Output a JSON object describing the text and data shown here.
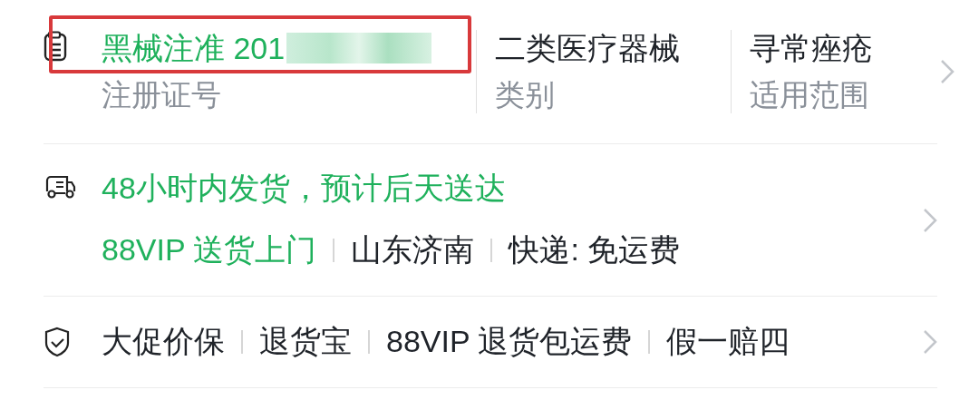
{
  "rows": [
    {
      "kind": "specs",
      "items": [
        {
          "value": "黑械注准 201",
          "label": "注册证号",
          "highlighted": true,
          "redacted": true
        },
        {
          "value": "二类医疗器械",
          "label": "类别",
          "highlighted": false,
          "redacted": false
        },
        {
          "value": "寻常痤疮",
          "label": "适用范围",
          "highlighted": false,
          "redacted": false
        }
      ]
    },
    {
      "kind": "delivery",
      "headline": "48小时内发货，预计后天送达",
      "tags": [
        {
          "text": "88VIP 送货上门",
          "accent": true
        },
        {
          "text": "山东济南",
          "accent": false
        },
        {
          "text": "快递: 免运费",
          "accent": false
        }
      ]
    },
    {
      "kind": "guarantee",
      "tags": [
        {
          "text": "大促价保",
          "accent": false
        },
        {
          "text": "退货宝",
          "accent": false
        },
        {
          "text": "88VIP 退货包运费",
          "accent": false
        },
        {
          "text": "假一赔四",
          "accent": false
        }
      ]
    }
  ]
}
